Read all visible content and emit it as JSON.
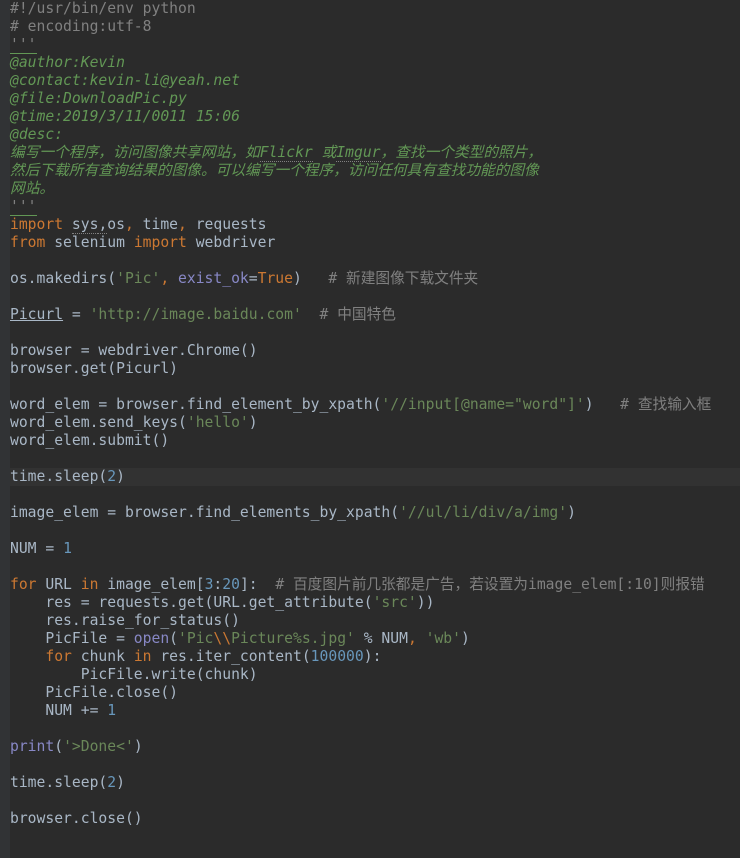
{
  "lines": [
    [
      [
        "cmt",
        "#!/usr/bin/env python"
      ]
    ],
    [
      [
        "cmt",
        "# encoding:utf-8"
      ]
    ],
    [
      [
        "docw",
        "'''"
      ]
    ],
    [
      [
        "docw",
        "~~~~~"
      ]
    ],
    [
      [
        "doc",
        "@author:Kevin"
      ]
    ],
    [
      [
        "doc",
        "@contact:kevin-li@yeah.net"
      ]
    ],
    [
      [
        "doc",
        "@file:DownloadPic.py"
      ]
    ],
    [
      [
        "doc",
        "@time:2019/3/11/0011 15:06"
      ]
    ],
    [
      [
        "doc",
        "@desc:"
      ]
    ],
    [
      [
        "doc",
        "编写一个程序，访问图像共享网站，如"
      ],
      [
        "docu",
        "Flickr"
      ],
      [
        "doc",
        " 或"
      ],
      [
        "docu",
        "Imgur"
      ],
      [
        "doc",
        "，查找一个类型的照片，"
      ]
    ],
    [
      [
        "doc",
        "然后下载所有查询结果的图像。可以编写一个程序，访问任何具有查找功能的图像"
      ]
    ],
    [
      [
        "doc",
        "网站。"
      ]
    ],
    [
      [
        "docw",
        "'''"
      ]
    ],
    [
      [
        "docw",
        "~~~~~"
      ]
    ],
    [
      [
        "kw",
        "import "
      ],
      [
        "warn",
        "sys"
      ],
      [
        "warn",
        ","
      ],
      [
        "txt",
        "os"
      ],
      [
        "kw",
        ", "
      ],
      [
        "txt",
        "time"
      ],
      [
        "kw",
        ", "
      ],
      [
        "txt",
        "requests"
      ]
    ],
    [
      [
        "kw",
        "from "
      ],
      [
        "txt",
        "selenium "
      ],
      [
        "kw",
        "import "
      ],
      [
        "txt",
        "webdriver"
      ]
    ],
    [
      [
        "txt",
        ""
      ]
    ],
    [
      [
        "txt",
        "os.makedirs("
      ],
      [
        "str",
        "'Pic'"
      ],
      [
        "kw",
        ", "
      ],
      [
        "bi",
        "exist_ok"
      ],
      [
        "txt",
        "="
      ],
      [
        "kw",
        "True"
      ],
      [
        "txt",
        ")   "
      ],
      [
        "cmt",
        "# 新建图像下载文件夹"
      ]
    ],
    [
      [
        "txt",
        ""
      ]
    ],
    [
      [
        "ul",
        "Picurl"
      ],
      [
        "txt",
        " = "
      ],
      [
        "str",
        "'http://image.baidu.com'"
      ],
      [
        "txt",
        "  "
      ],
      [
        "cmt",
        "# 中国特色"
      ]
    ],
    [
      [
        "txt",
        ""
      ]
    ],
    [
      [
        "txt",
        "browser = webdriver.Chrome()"
      ]
    ],
    [
      [
        "txt",
        "browser.get(Picurl)"
      ]
    ],
    [
      [
        "txt",
        ""
      ]
    ],
    [
      [
        "txt",
        "word_elem = browser.find_element_by_xpath("
      ],
      [
        "str",
        "'//input[@name=\"word\"]'"
      ],
      [
        "txt",
        ")   "
      ],
      [
        "cmt",
        "# 查找输入框"
      ]
    ],
    [
      [
        "txt",
        "word_elem.send_keys("
      ],
      [
        "str",
        "'hello'"
      ],
      [
        "txt",
        ")"
      ]
    ],
    [
      [
        "txt",
        "word_elem.submit()"
      ]
    ],
    [
      [
        "txt",
        ""
      ]
    ],
    [
      [
        "txt",
        "time.sleep("
      ],
      [
        "num",
        "2"
      ],
      [
        "txt",
        ")"
      ]
    ],
    [
      [
        "txt",
        ""
      ]
    ],
    [
      [
        "txt",
        "image_elem = browser.find_elements_by_xpath("
      ],
      [
        "str",
        "'//ul/li/div/a/img'"
      ],
      [
        "txt",
        ")"
      ]
    ],
    [
      [
        "txt",
        ""
      ]
    ],
    [
      [
        "txt",
        "NUM = "
      ],
      [
        "num",
        "1"
      ]
    ],
    [
      [
        "txt",
        ""
      ]
    ],
    [
      [
        "kw",
        "for "
      ],
      [
        "txt",
        "URL "
      ],
      [
        "kw",
        "in "
      ],
      [
        "txt",
        "image_elem["
      ],
      [
        "num",
        "3"
      ],
      [
        "txt",
        ":"
      ],
      [
        "num",
        "20"
      ],
      [
        "txt",
        "]:  "
      ],
      [
        "cmt",
        "# 百度图片前几张都是广告，若设置为image_elem[:10]则报错"
      ]
    ],
    [
      [
        "txt",
        "    res = requests.get(URL.get_attribute("
      ],
      [
        "str",
        "'src'"
      ],
      [
        "txt",
        "))"
      ]
    ],
    [
      [
        "txt",
        "    res.raise_for_status()"
      ]
    ],
    [
      [
        "txt",
        "    PicFile = "
      ],
      [
        "bi",
        "open"
      ],
      [
        "txt",
        "("
      ],
      [
        "str",
        "'Pic"
      ],
      [
        "kw",
        "\\\\"
      ],
      [
        "str",
        "Picture%s.jpg' "
      ],
      [
        "txt",
        "% NUM"
      ],
      [
        "kw",
        ", "
      ],
      [
        "str",
        "'wb'"
      ],
      [
        "txt",
        ")"
      ]
    ],
    [
      [
        "txt",
        "    "
      ],
      [
        "kw",
        "for "
      ],
      [
        "txt",
        "chunk "
      ],
      [
        "kw",
        "in "
      ],
      [
        "txt",
        "res.iter_content("
      ],
      [
        "num",
        "100000"
      ],
      [
        "txt",
        "):"
      ]
    ],
    [
      [
        "txt",
        "        PicFile.write(chunk)"
      ]
    ],
    [
      [
        "txt",
        "    PicFile.close()"
      ]
    ],
    [
      [
        "txt",
        "    NUM += "
      ],
      [
        "num",
        "1"
      ]
    ],
    [
      [
        "txt",
        ""
      ]
    ],
    [
      [
        "bi",
        "print"
      ],
      [
        "txt",
        "("
      ],
      [
        "str",
        "'>Done<'"
      ],
      [
        "txt",
        ")"
      ]
    ],
    [
      [
        "txt",
        ""
      ]
    ],
    [
      [
        "txt",
        "time.sleep("
      ],
      [
        "num",
        "2"
      ],
      [
        "txt",
        ")"
      ]
    ],
    [
      [
        "txt",
        ""
      ]
    ],
    [
      [
        "txt",
        "browser.close()"
      ]
    ]
  ],
  "highlight_line_index": 28
}
